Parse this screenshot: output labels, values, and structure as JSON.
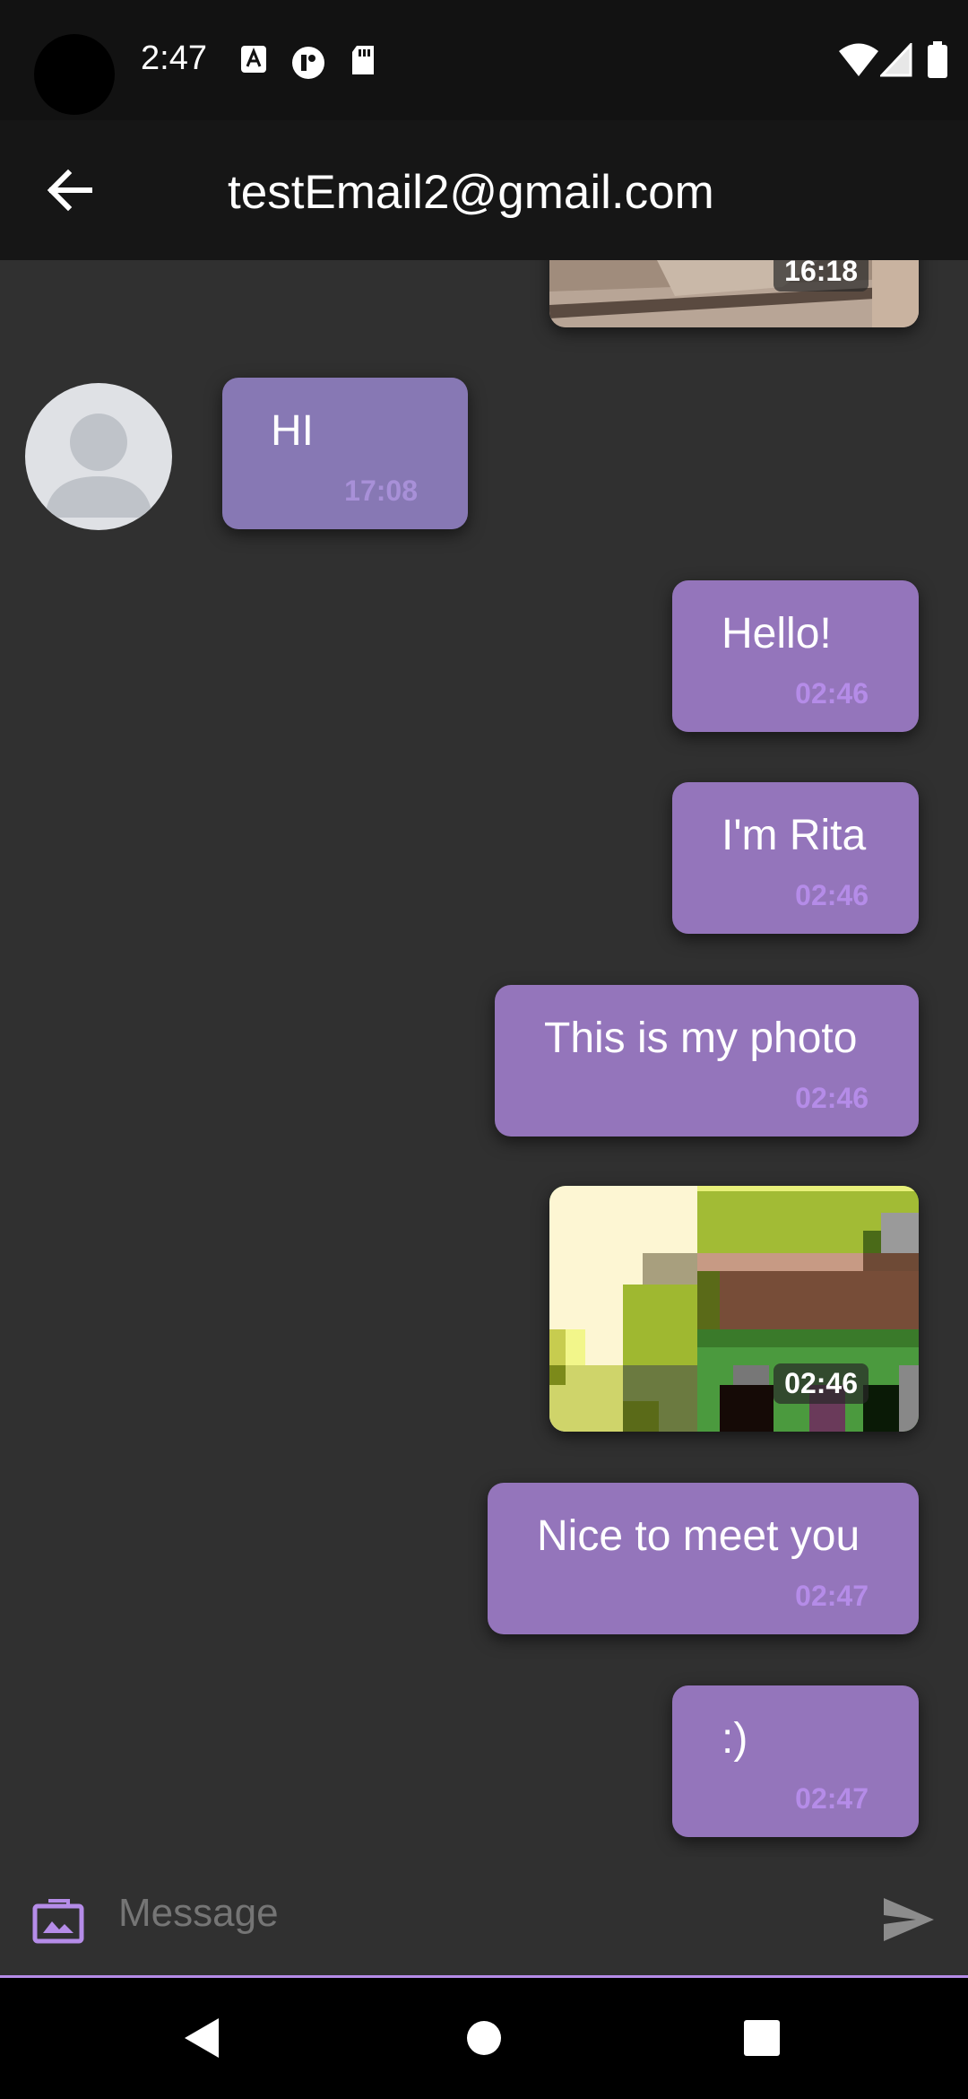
{
  "status_bar": {
    "time": "2:47"
  },
  "header": {
    "title": "testEmail2@gmail.com"
  },
  "messages": [
    {
      "type": "image",
      "direction": "sent",
      "time": "16:18"
    },
    {
      "type": "text",
      "direction": "received",
      "text": "HI",
      "time": "17:08"
    },
    {
      "type": "text",
      "direction": "sent",
      "text": "Hello!",
      "time": "02:46"
    },
    {
      "type": "text",
      "direction": "sent",
      "text": "I'm Rita",
      "time": "02:46"
    },
    {
      "type": "text",
      "direction": "sent",
      "text": "This is my photo",
      "time": "02:46"
    },
    {
      "type": "image",
      "direction": "sent",
      "time": "02:46"
    },
    {
      "type": "text",
      "direction": "sent",
      "text": "Nice to meet you",
      "time": "02:47"
    },
    {
      "type": "text",
      "direction": "sent",
      "text": ":)",
      "time": "02:47"
    }
  ],
  "composer": {
    "placeholder": "Message"
  },
  "colors": {
    "accent": "#b58ce8",
    "sent_bubble": "#9475bb",
    "received_bubble": "#8778b4",
    "background": "#303030"
  }
}
